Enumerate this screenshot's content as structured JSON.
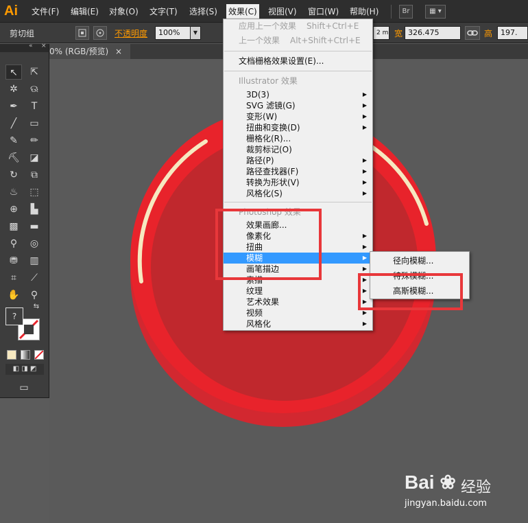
{
  "app_logo": "Ai",
  "menubar": {
    "items": [
      "文件(F)",
      "编辑(E)",
      "对象(O)",
      "文字(T)",
      "选择(S)",
      "效果(C)",
      "视图(V)",
      "窗口(W)",
      "帮助(H)"
    ],
    "bridge_label": "Br"
  },
  "controlbar": {
    "group_label": "剪切组",
    "opacity_label": "不透明度",
    "opacity_value": "100%",
    "x_value": "2 m",
    "width_label": "宽",
    "width_value": "326.475",
    "height_label": "高",
    "height_value": "197."
  },
  "doc_tab": {
    "label": "0% (RGB/预览)",
    "close": "×"
  },
  "tools_panel": {
    "collapse": "«",
    "close": "×",
    "fill_icon": "?"
  },
  "effect_menu": {
    "apply_last": "应用上一个效果",
    "apply_last_shortcut": "Shift+Ctrl+E",
    "last_effect": "上一个效果",
    "last_effect_shortcut": "Alt+Shift+Ctrl+E",
    "raster_settings": "文档栅格效果设置(E)...",
    "illustrator_header": "Illustrator 效果",
    "illustrator_items": [
      "3D(3)",
      "SVG 滤镜(G)",
      "变形(W)",
      "扭曲和变换(D)",
      "栅格化(R)...",
      "裁剪标记(O)",
      "路径(P)",
      "路径查找器(F)",
      "转换为形状(V)",
      "风格化(S)"
    ],
    "photoshop_header": "Photoshop 效果",
    "photoshop_items": [
      "效果画廊...",
      "像素化",
      "扭曲",
      "模糊",
      "画笔描边",
      "素描",
      "纹理",
      "艺术效果",
      "视频",
      "风格化"
    ]
  },
  "blur_submenu": {
    "items": [
      "径向模糊...",
      "特殊模糊...",
      "高斯模糊..."
    ]
  },
  "watermark": {
    "logo": "Bai",
    "logo_suffix": "经验",
    "url": "jingyan.baidu.com"
  },
  "colors": {
    "menubar_bg": "#2e2e2e",
    "canvas_bg": "#5a5a5a",
    "red_outer": "#e8232b",
    "red_inner": "#c0282d",
    "highlight_ring": "#f6e8c0",
    "menu_highlight": "#3399ff",
    "annotation_red": "#e8373a",
    "logo_orange": "#ff9a00"
  }
}
